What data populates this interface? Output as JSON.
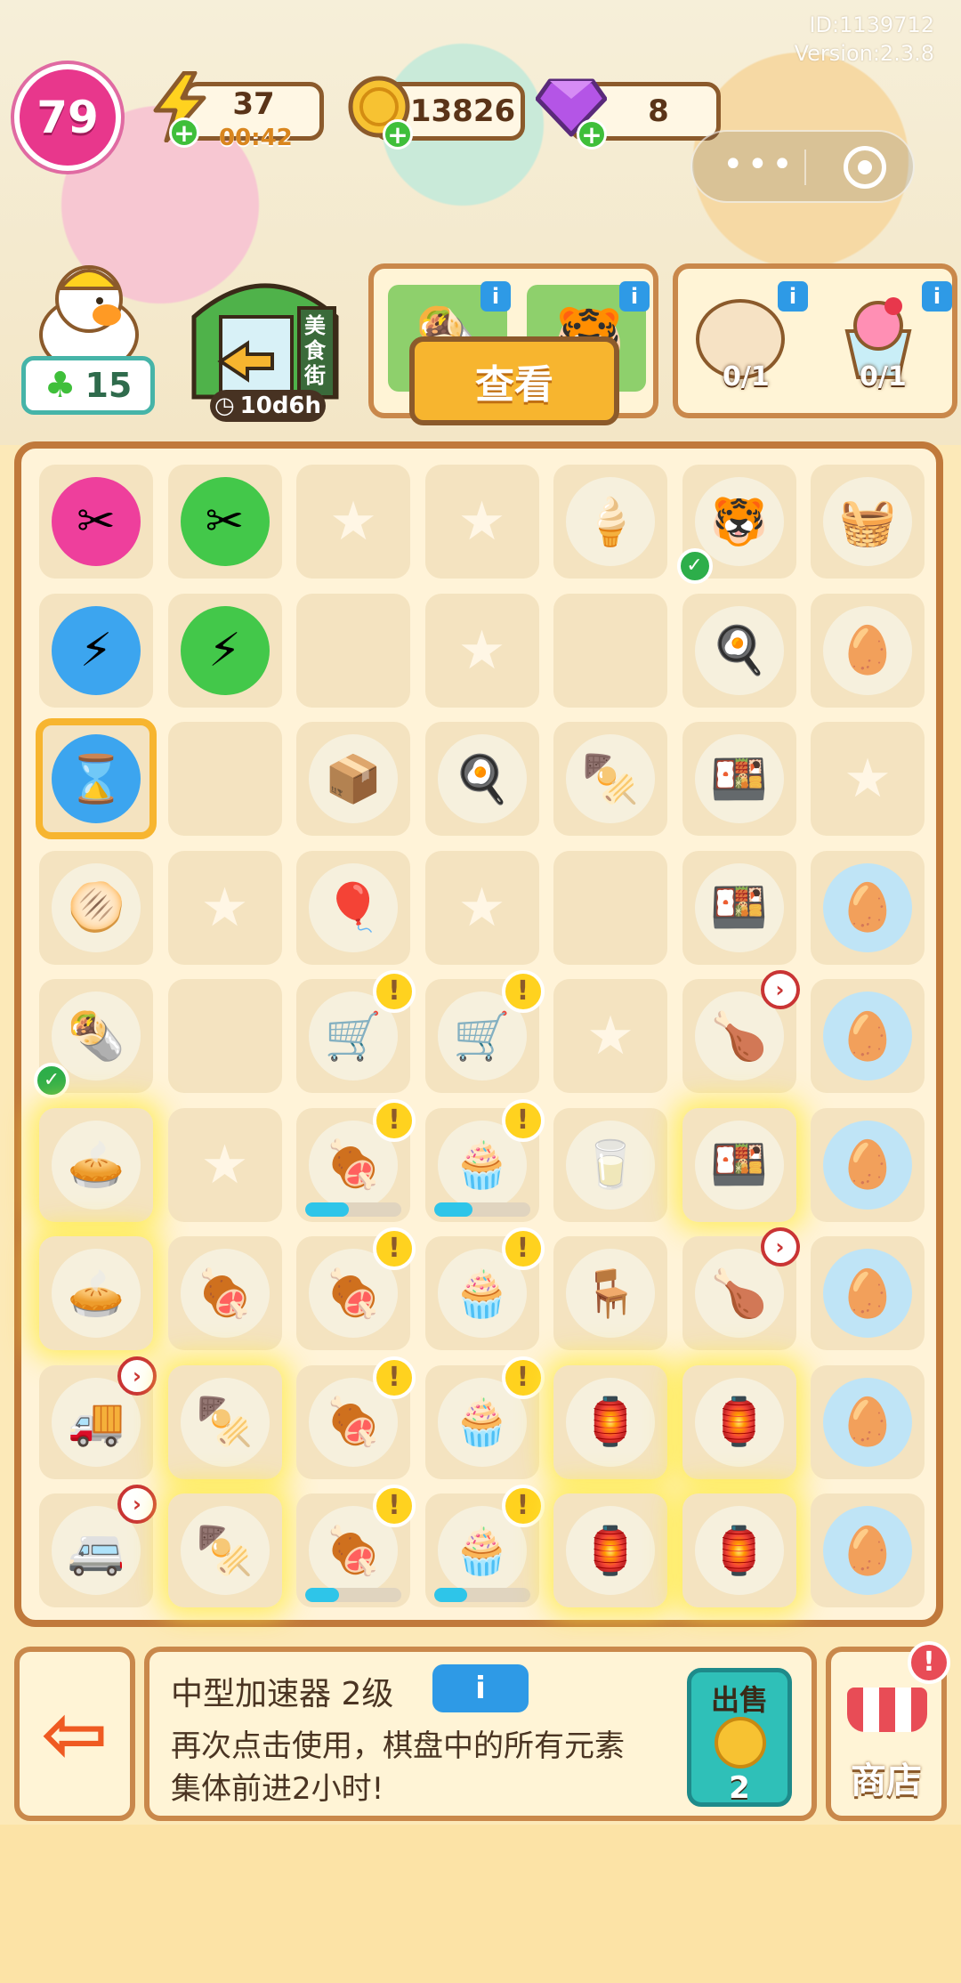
{
  "version": {
    "id_line": "ID:1139712",
    "version_line": "Version:2.3.8"
  },
  "player": {
    "level": "79"
  },
  "energy": {
    "value": "37",
    "timer": "00:42",
    "icon": "lightning-icon"
  },
  "coins": {
    "value": "13826",
    "icon": "coin-icon"
  },
  "gems": {
    "value": "8",
    "icon": "gem-icon"
  },
  "wechat_capsule": {
    "menu": "•••",
    "close": "target-icon"
  },
  "clover": {
    "count": "15",
    "icon": "clover-icon"
  },
  "food_street": {
    "sign": "美食街",
    "timer": "10d6h"
  },
  "orders": {
    "view_button": "查看"
  },
  "requests": [
    {
      "icon": "dough-icon",
      "progress": "0/1"
    },
    {
      "icon": "shaved-ice-icon",
      "progress": "0/1"
    }
  ],
  "board": [
    [
      {
        "icon": "✂",
        "color": "#ee3f9c"
      },
      {
        "icon": "✂",
        "color": "#43c84a"
      },
      {
        "empty": true
      },
      {
        "empty": true
      },
      {
        "icon": "🍦",
        "color": "#f6f0dd"
      },
      {
        "icon": "🐯",
        "color": "#f6f0dd",
        "check": true
      },
      {
        "icon": "🧺",
        "color": "#f6f0dd"
      }
    ],
    [
      {
        "icon": "⚡",
        "color": "#3ca5ef"
      },
      {
        "icon": "⚡",
        "color": "#43c84a"
      },
      {
        "blank": true
      },
      {
        "empty": true
      },
      {
        "blank": true
      },
      {
        "icon": "🍳",
        "color": "#f6f0dd"
      },
      {
        "icon": "🥚",
        "color": "#f6f0dd"
      }
    ],
    [
      {
        "icon": "⌛",
        "color": "#3ca5ef",
        "selected": true
      },
      {
        "blank": true
      },
      {
        "icon": "📦",
        "color": "#f6f0dd"
      },
      {
        "icon": "🍳",
        "color": "#f6f0dd"
      },
      {
        "icon": "🍢",
        "color": "#f6f0dd"
      },
      {
        "icon": "🍱",
        "color": "#f6f0dd"
      },
      {
        "empty": true
      }
    ],
    [
      {
        "icon": "🫓",
        "color": "#f6f0dd"
      },
      {
        "empty": true
      },
      {
        "icon": "🎈",
        "color": "#f6f0dd"
      },
      {
        "empty": true
      },
      {
        "blank": true
      },
      {
        "icon": "🍱",
        "color": "#f6f0dd"
      },
      {
        "icon": "🥚",
        "color": "#bfe4f6"
      }
    ],
    [
      {
        "icon": "🌯",
        "color": "#f6f0dd",
        "check": true
      },
      {
        "blank": true
      },
      {
        "icon": "🛒",
        "color": "#f6f0dd",
        "excl": true
      },
      {
        "icon": "🛒",
        "color": "#f6f0dd",
        "excl": true
      },
      {
        "empty": true
      },
      {
        "icon": "🍗",
        "color": "#f6f0dd",
        "clock": true
      },
      {
        "icon": "🥚",
        "color": "#bfe4f6"
      }
    ],
    [
      {
        "icon": "🥧",
        "color": "#f6f0dd",
        "glow": true
      },
      {
        "empty": true
      },
      {
        "icon": "🍖",
        "color": "#f6f0dd",
        "excl": true,
        "progress": 0.45
      },
      {
        "icon": "🧁",
        "color": "#f6f0dd",
        "excl": true,
        "progress": 0.4
      },
      {
        "icon": "🥛",
        "color": "#f6f0dd"
      },
      {
        "icon": "🍱",
        "color": "#f6f0dd",
        "glow": true
      },
      {
        "icon": "🥚",
        "color": "#bfe4f6"
      }
    ],
    [
      {
        "icon": "🥧",
        "color": "#f6f0dd",
        "glow": true
      },
      {
        "icon": "🍖",
        "color": "#f6f0dd"
      },
      {
        "icon": "🍖",
        "color": "#f6f0dd",
        "excl": true
      },
      {
        "icon": "🧁",
        "color": "#f6f0dd",
        "excl": true
      },
      {
        "icon": "🪑",
        "color": "#f6f0dd"
      },
      {
        "icon": "🍗",
        "color": "#f6f0dd",
        "clock": true
      },
      {
        "icon": "🥚",
        "color": "#bfe4f6"
      }
    ],
    [
      {
        "icon": "🚚",
        "color": "#f6f0dd",
        "clock": true
      },
      {
        "icon": "🍢",
        "color": "#f6f0dd",
        "glow": true
      },
      {
        "icon": "🍖",
        "color": "#f6f0dd",
        "excl": true
      },
      {
        "icon": "🧁",
        "color": "#f6f0dd",
        "excl": true
      },
      {
        "icon": "🏮",
        "color": "#f6f0dd",
        "glow": true
      },
      {
        "icon": "🏮",
        "color": "#f6f0dd",
        "glow": true
      },
      {
        "icon": "🥚",
        "color": "#bfe4f6"
      }
    ],
    [
      {
        "icon": "🚐",
        "color": "#f6f0dd",
        "clock": true
      },
      {
        "icon": "🍢",
        "color": "#f6f0dd",
        "glow": true
      },
      {
        "icon": "🍖",
        "color": "#f6f0dd",
        "excl": true,
        "progress": 0.35
      },
      {
        "icon": "🧁",
        "color": "#f6f0dd",
        "excl": true,
        "progress": 0.35
      },
      {
        "icon": "🏮",
        "color": "#f6f0dd",
        "glow": true
      },
      {
        "icon": "🏮",
        "color": "#f6f0dd",
        "glow": true
      },
      {
        "icon": "🥚",
        "color": "#bfe4f6"
      }
    ]
  ],
  "selected_item": {
    "title": "中型加速器 2级",
    "info_button": "i",
    "description": "再次点击使用，棋盘中的所有元素集体前进2小时!",
    "sell_label": "出售",
    "sell_price": "2"
  },
  "exit": {
    "icon": "exit-icon",
    "glyph": "⇦"
  },
  "shop": {
    "label": "商店",
    "badge": "!"
  }
}
